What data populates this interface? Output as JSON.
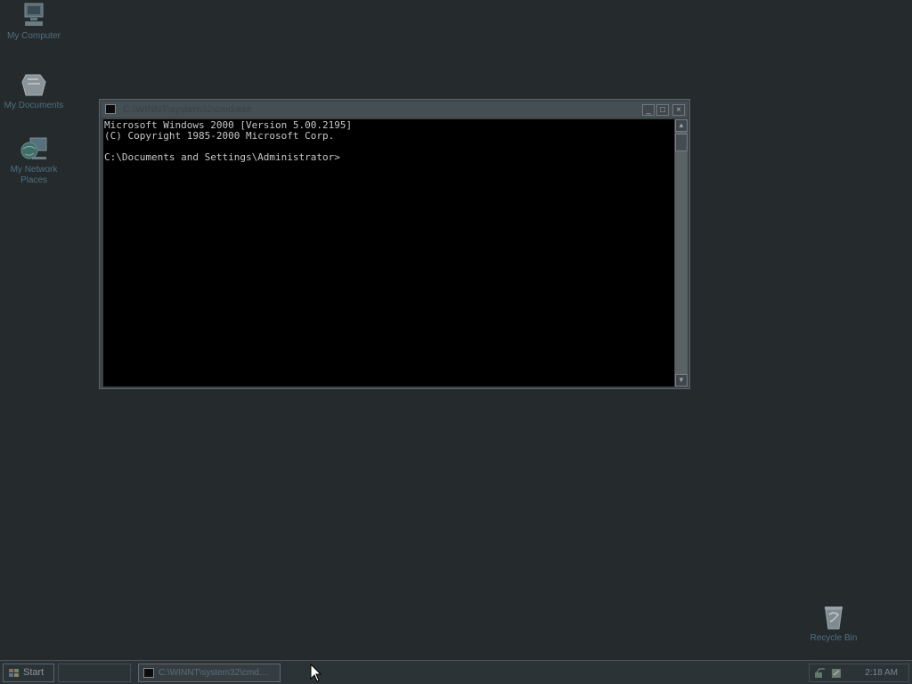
{
  "desktop": {
    "icons": [
      {
        "label": "My Computer",
        "icon": "computer-icon"
      },
      {
        "label": "My Documents",
        "icon": "folder-documents-icon"
      },
      {
        "label_lines": [
          "My Network",
          "Places"
        ],
        "icon": "network-globe-icon"
      },
      {
        "label": "Recycle Bin",
        "icon": "recycle-bin-icon"
      }
    ]
  },
  "window": {
    "title": "C:\\WINNT\\system32\\cmd.exe",
    "buttons": {
      "minimize": "_",
      "maximize": "□",
      "close": "×"
    },
    "console_lines": [
      "Microsoft Windows 2000 [Version 5.00.2195]",
      "(C) Copyright 1985-2000 Microsoft Corp.",
      "",
      "C:\\Documents and Settings\\Administrator>"
    ],
    "scrollbar": {
      "up": "▲",
      "down": "▼"
    }
  },
  "taskbar": {
    "start_label": "Start",
    "task_label": "C:\\WINNT\\system32\\cmd....",
    "clock": "2:18 AM"
  },
  "colors": {
    "desktop": "#252a2d",
    "console_bg": "#000000",
    "console_text": "#c8c8c8",
    "icon_label": "#4f6f7f"
  }
}
